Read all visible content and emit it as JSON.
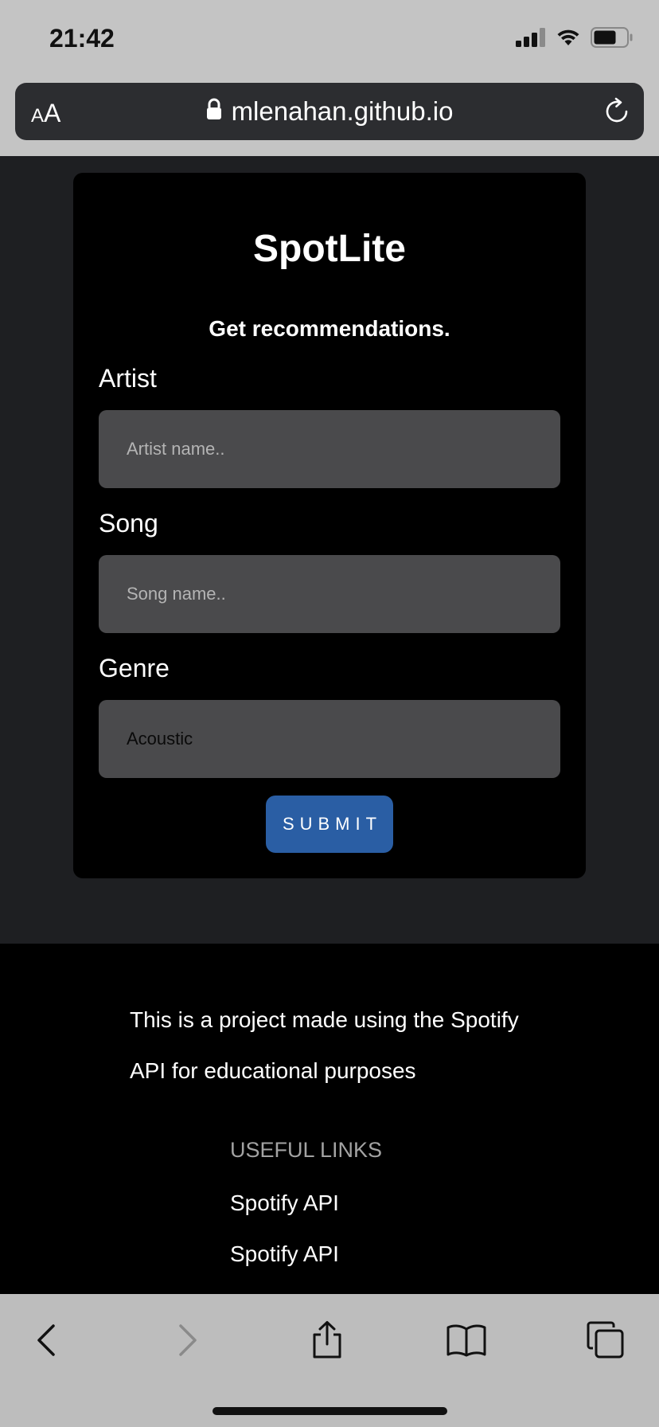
{
  "status_bar": {
    "time": "21:42",
    "icons": [
      "signal-icon",
      "wifi-icon",
      "battery-icon"
    ]
  },
  "browser": {
    "text_size_small": "A",
    "text_size_large": "A",
    "url": "mlenahan.github.io",
    "icons": [
      "lock-icon",
      "reload-icon"
    ]
  },
  "form": {
    "title": "SpotLite",
    "subtitle": "Get recommendations.",
    "artist_label": "Artist",
    "artist_placeholder": "Artist name..",
    "artist_value": "",
    "song_label": "Song",
    "song_placeholder": "Song name..",
    "song_value": "",
    "genre_label": "Genre",
    "genre_selected": "Acoustic",
    "submit_label": "SUBMIT"
  },
  "footer": {
    "description": "This is a project made using the Spotify API for educational purposes",
    "links_heading": "USEFUL LINKS",
    "links": [
      "Spotify API",
      "Spotify API"
    ]
  },
  "toolbar": {
    "icons": [
      "back-icon",
      "forward-icon",
      "share-icon",
      "bookmarks-icon",
      "tabs-icon"
    ]
  },
  "colors": {
    "page_background": "#1e1f22",
    "card_background": "#000000",
    "field_background": "#4a4a4c",
    "submit_background": "#2a5ea4",
    "browser_chrome": "#c4c4c4"
  }
}
